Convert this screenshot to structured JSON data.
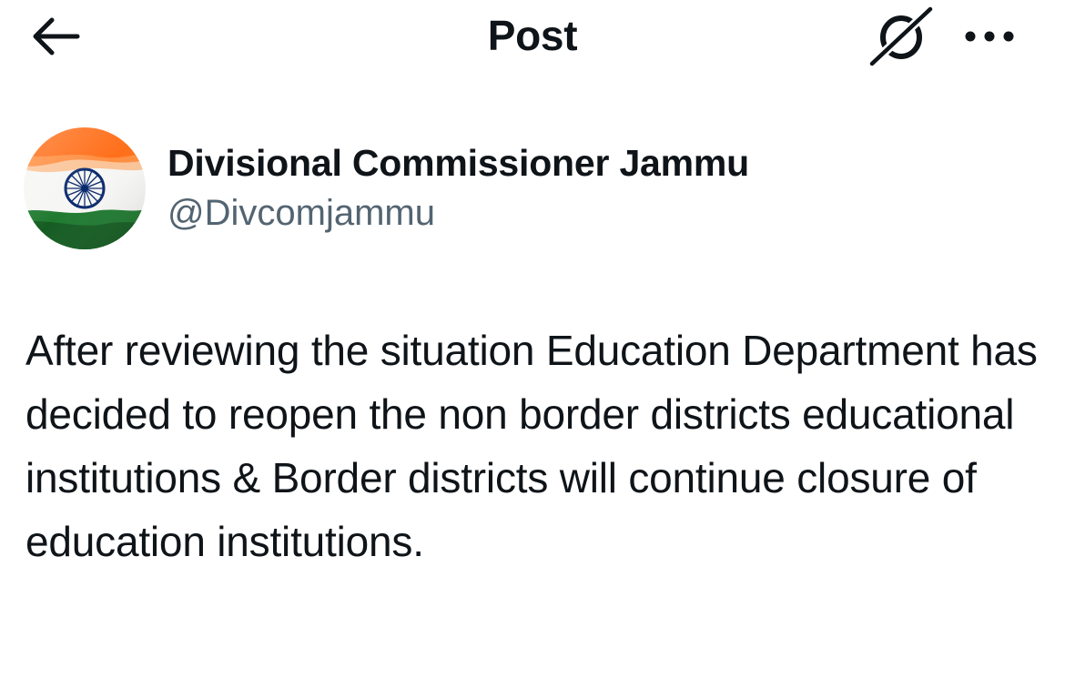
{
  "header": {
    "title": "Post",
    "back_icon": "arrow-left-icon",
    "grok_icon": "grok-icon",
    "more_icon": "more-horizontal-icon"
  },
  "author": {
    "display_name": "Divisional Commissioner Jammu",
    "handle": "@Divcomjammu",
    "avatar": "indian-flag-avatar"
  },
  "post": {
    "text": "After reviewing the situation Education Department has decided to reopen the non border districts educational institutions & Border districts will continue closure of education institutions."
  },
  "colors": {
    "text_primary": "#0f1419",
    "text_secondary": "#536471",
    "saffron": "#ff7a1a",
    "green": "#1e7a2e",
    "navy": "#0a2a6e"
  }
}
